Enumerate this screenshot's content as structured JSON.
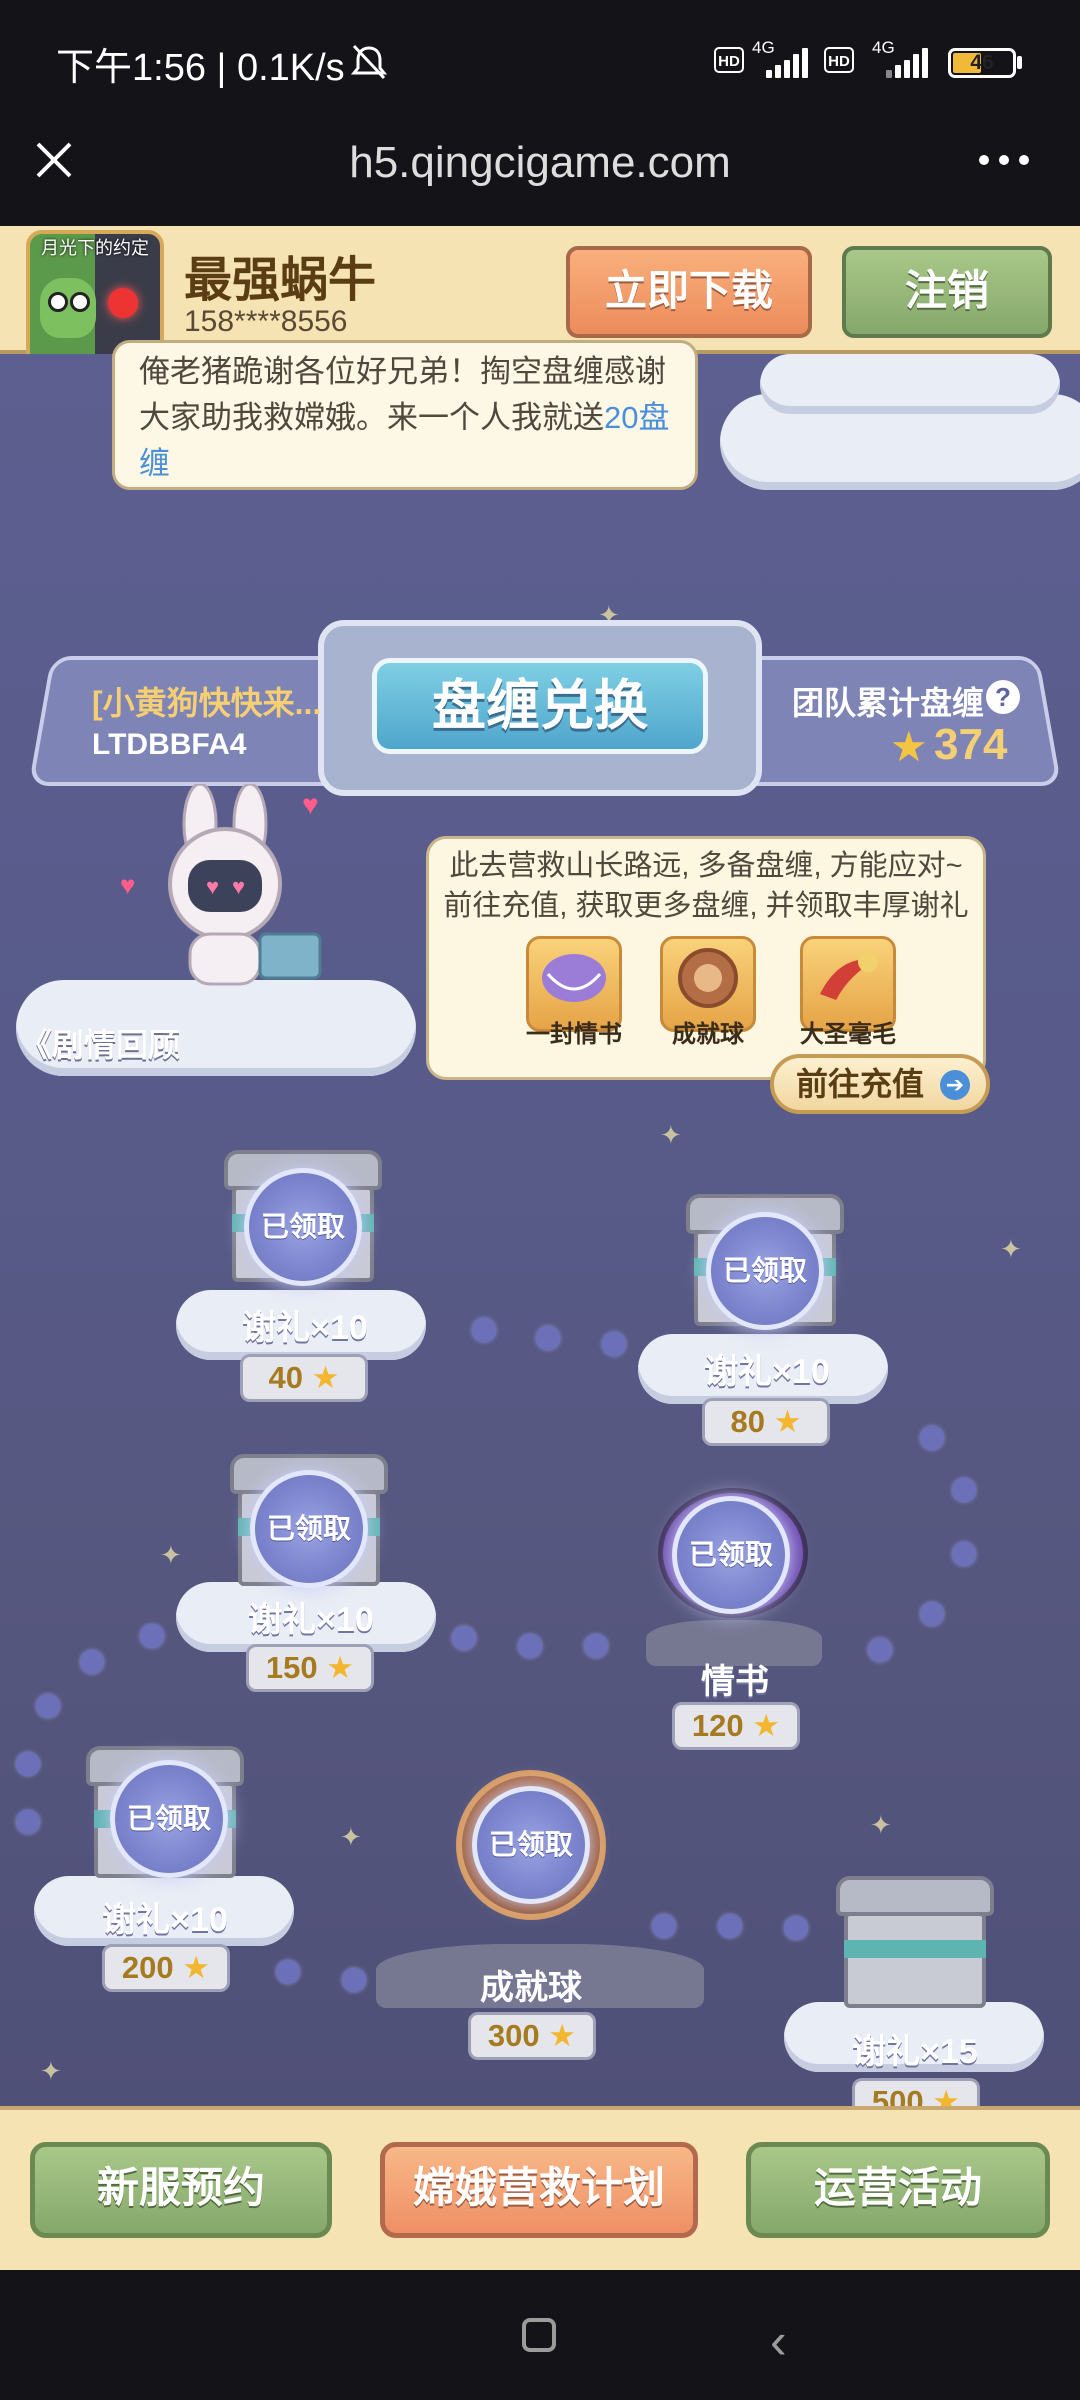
{
  "status_bar": {
    "time": "下午1:56 | 0.1K/s",
    "network_1": "4G",
    "network_2": "4G",
    "hd_1": "HD",
    "hd_2": "HD",
    "battery": "46"
  },
  "browser": {
    "url": "h5.qingcigame.com",
    "close_icon": "close-icon",
    "more_icon": "more-icon"
  },
  "header": {
    "game_name": "最强蜗牛",
    "phone": "158****8556",
    "avatar_text": "月光下的约定",
    "download_label": "立即下载",
    "logout_label": "注销"
  },
  "bubble_top": {
    "text": "俺老猪跪谢各位好兄弟！掏空盘缠感谢大家助我救嫦娥。来一个人我就送",
    "highlight": "20盘缠"
  },
  "exchange": {
    "title": "盘缠兑换",
    "team_name": "[小黄狗快快来...",
    "team_code": "LTDBBFA4",
    "team_total_label": "团队累计盘缠",
    "team_total": "374"
  },
  "story": {
    "label": "《剧情回顾"
  },
  "recharge": {
    "line1": "此去营救山长路远, 多备盘缠, 方能应对~",
    "line2": "前往充值, 获取更多盘缠, 并领取丰厚谢礼",
    "rewards": [
      "一封情书",
      "成就球",
      "大圣毫毛"
    ],
    "button_label": "前往充值"
  },
  "claimed_label": "已领取",
  "items": [
    {
      "label": "谢礼×10",
      "cost": "40"
    },
    {
      "label": "谢礼×10",
      "cost": "80"
    },
    {
      "label": "谢礼×10",
      "cost": "150"
    },
    {
      "label": "情书",
      "cost": "120"
    },
    {
      "label": "谢礼×10",
      "cost": "200"
    },
    {
      "label": "成就球",
      "cost": "300"
    },
    {
      "label": "谢礼×15",
      "cost": "500"
    }
  ],
  "bottom_nav": {
    "reserve": "新服预约",
    "rescue": "嫦娥营救计划",
    "events": "运营活动"
  },
  "colors": {
    "header_bg": "#f6e3b4",
    "game_bg": "#5c5f8f",
    "accent_gold": "#f5cf73",
    "button_green": "#85a86b",
    "button_orange": "#ef8f66"
  }
}
